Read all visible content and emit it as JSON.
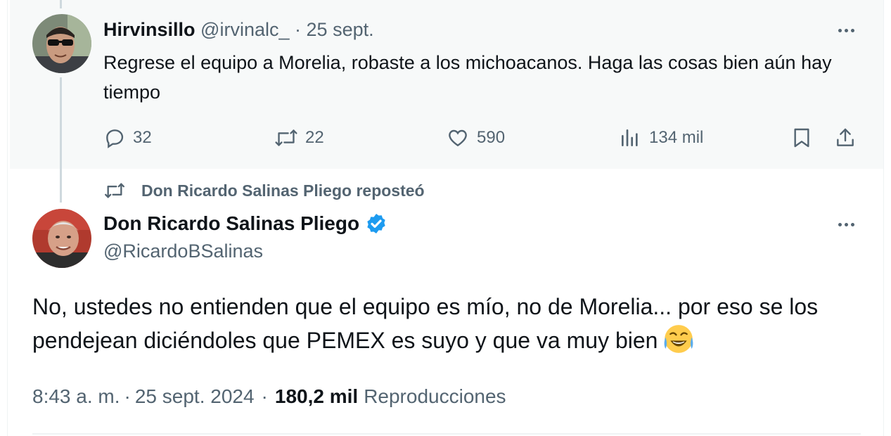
{
  "parent_tweet": {
    "author_name": "Hirvinsillo",
    "handle": "@irvinalc_",
    "separator": "·",
    "date": "25 sept.",
    "text": "Regrese el equipo a Morelia, robaste a los michoacanos. Haga las cosas bien aún hay tiempo",
    "replies": "32",
    "reposts": "22",
    "likes": "590",
    "views": "134 mil",
    "icons": [
      "more-icon",
      "reply-icon",
      "repost-icon",
      "like-icon",
      "views-icon",
      "bookmark-icon",
      "share-icon"
    ]
  },
  "repost_banner": {
    "text": "Don Ricardo Salinas Pliego reposteó",
    "icon": "repost-icon"
  },
  "main_tweet": {
    "author_name": "Don Ricardo Salinas Pliego",
    "verified": true,
    "handle": "@RicardoBSalinas",
    "text": "No, ustedes no entienden que el equipo es mío, no de Morelia... por eso se los pendejean diciéndoles que PEMEX es suyo y que va muy bien",
    "emoji": "😂",
    "time": "8:43 a. m.",
    "date_sep": "·",
    "date": "25 sept. 2024",
    "views_sep": "·",
    "views_count": "180,2 mil",
    "views_label": "Reproducciones"
  },
  "colors": {
    "text": "#0f1419",
    "muted": "#536471",
    "verified_blue": "#1d9bf0",
    "parent_bg": "#f7f9f9",
    "thread_line": "#cfd9de"
  }
}
